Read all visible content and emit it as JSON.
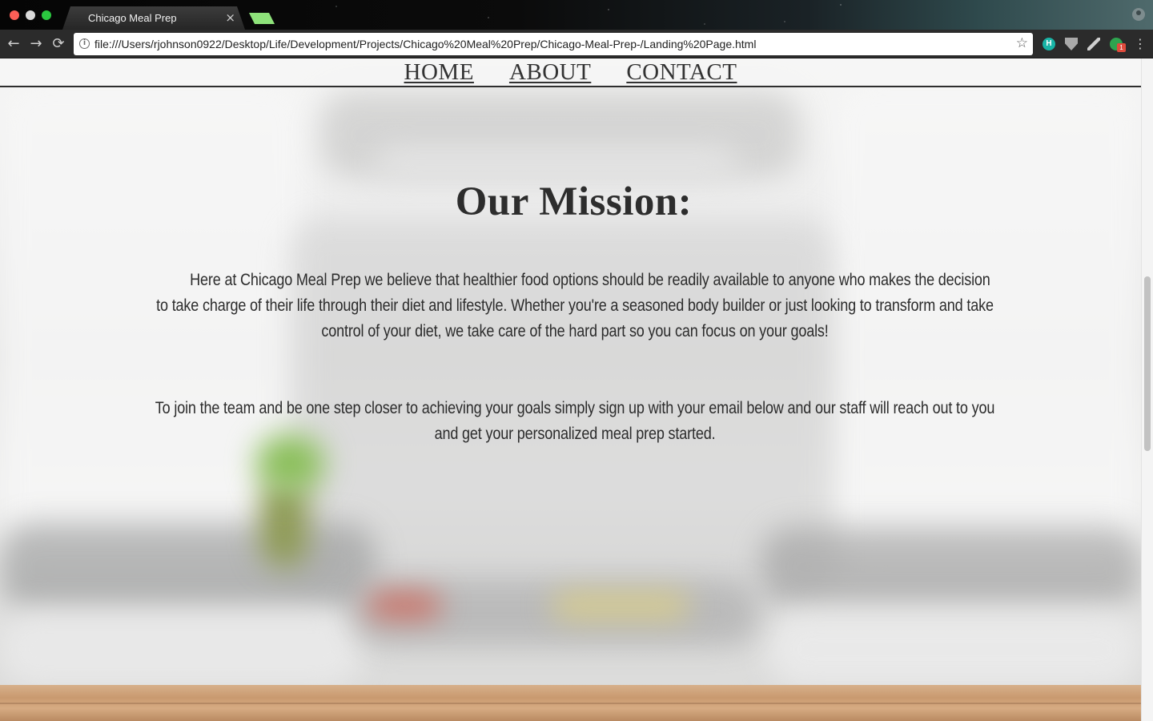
{
  "browser": {
    "tab_title": "Chicago Meal Prep",
    "tab_close": "×",
    "url": "file:///Users/rjohnson0922/Desktop/Life/Development/Projects/Chicago%20Meal%20Prep/Chicago-Meal-Prep-/Landing%20Page.html",
    "back_icon": "←",
    "forward_icon": "→",
    "reload_icon": "⟳",
    "info_icon": "i",
    "star_icon": "☆",
    "menu_icon": "⋮",
    "extension_h_label": "H",
    "extension_badge": "1"
  },
  "nav": {
    "links": [
      "HOME",
      "ABOUT",
      "CONTACT"
    ]
  },
  "mission": {
    "title": "Our Mission:",
    "paragraph1": "Here at Chicago Meal Prep we believe that healthier food options should be readily available to anyone who makes the decision to take charge of their life through their diet and lifestyle. Whether you're a seasoned body builder or just looking to transform and take control of your diet, we take care of the hard part so you can focus on your goals!",
    "paragraph2": "To join the team and be one step closer to achieving your goals simply sign up with your email below and our staff will reach out to you and get your personalized meal prep started."
  },
  "colors": {
    "nav_text": "#333333",
    "heading_text": "#2d2d2d",
    "body_text": "#2c2c2c",
    "tab_accent": "#8ee27a"
  }
}
